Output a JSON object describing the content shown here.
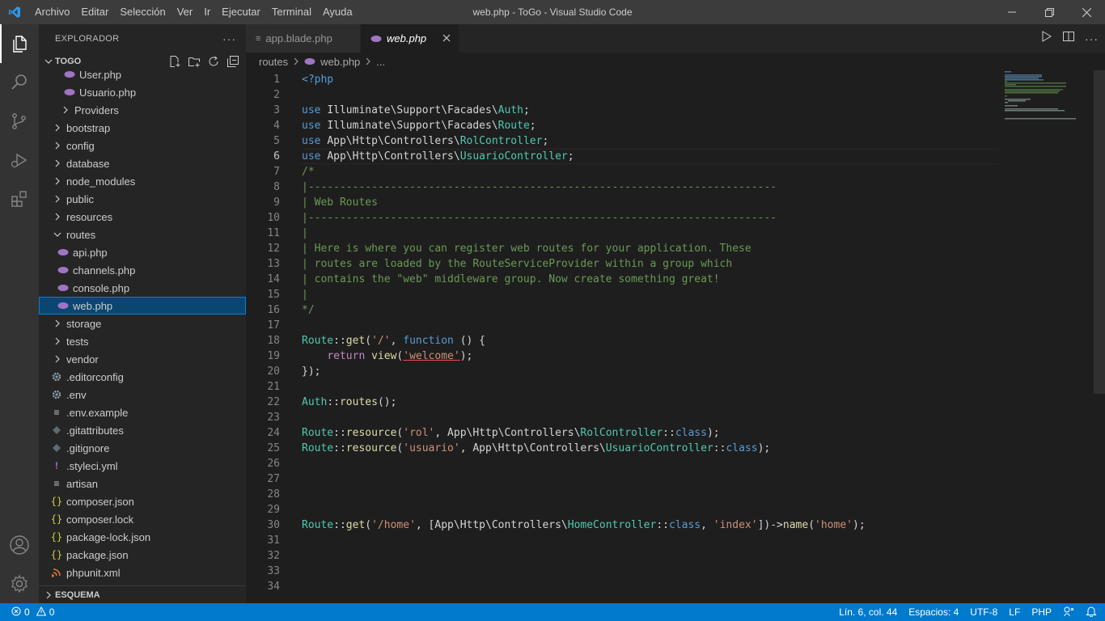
{
  "titlebar": {
    "menu": [
      "Archivo",
      "Editar",
      "Selección",
      "Ver",
      "Ir",
      "Ejecutar",
      "Terminal",
      "Ayuda"
    ],
    "title": "web.php - ToGo - Visual Studio Code"
  },
  "sidebar": {
    "header": "EXPLORADOR",
    "project": "TOGO",
    "outline": "ESQUEMA",
    "tree": [
      {
        "label": "User.php",
        "kind": "php",
        "depth": 2
      },
      {
        "label": "Usuario.php",
        "kind": "php",
        "depth": 2
      },
      {
        "label": "Providers",
        "kind": "folder",
        "depth": 2
      },
      {
        "label": "bootstrap",
        "kind": "folder",
        "depth": 1
      },
      {
        "label": "config",
        "kind": "folder",
        "depth": 1
      },
      {
        "label": "database",
        "kind": "folder",
        "depth": 1
      },
      {
        "label": "node_modules",
        "kind": "folder",
        "depth": 1
      },
      {
        "label": "public",
        "kind": "folder",
        "depth": 1
      },
      {
        "label": "resources",
        "kind": "folder",
        "depth": 1
      },
      {
        "label": "routes",
        "kind": "folder-open",
        "depth": 1
      },
      {
        "label": "api.php",
        "kind": "php",
        "depth": 2
      },
      {
        "label": "channels.php",
        "kind": "php",
        "depth": 2
      },
      {
        "label": "console.php",
        "kind": "php",
        "depth": 2
      },
      {
        "label": "web.php",
        "kind": "php",
        "depth": 2,
        "selected": true
      },
      {
        "label": "storage",
        "kind": "folder",
        "depth": 1
      },
      {
        "label": "tests",
        "kind": "folder",
        "depth": 1
      },
      {
        "label": "vendor",
        "kind": "folder",
        "depth": 1
      },
      {
        "label": ".editorconfig",
        "kind": "gear",
        "depth": 1
      },
      {
        "label": ".env",
        "kind": "gear",
        "depth": 1
      },
      {
        "label": ".env.example",
        "kind": "lines",
        "depth": 1
      },
      {
        "label": ".gitattributes",
        "kind": "git",
        "depth": 1
      },
      {
        "label": ".gitignore",
        "kind": "git",
        "depth": 1
      },
      {
        "label": ".styleci.yml",
        "kind": "yml",
        "depth": 1
      },
      {
        "label": "artisan",
        "kind": "lines",
        "depth": 1
      },
      {
        "label": "composer.json",
        "kind": "json",
        "depth": 1
      },
      {
        "label": "composer.lock",
        "kind": "json",
        "depth": 1
      },
      {
        "label": "package-lock.json",
        "kind": "json",
        "depth": 1
      },
      {
        "label": "package.json",
        "kind": "json",
        "depth": 1
      },
      {
        "label": "phpunit.xml",
        "kind": "rss",
        "depth": 1
      }
    ]
  },
  "tabs": [
    {
      "label": "app.blade.php",
      "active": false
    },
    {
      "label": "web.php",
      "active": true
    }
  ],
  "breadcrumb": {
    "folder": "routes",
    "file": "web.php",
    "more": "..."
  },
  "editor": {
    "current_line": 6,
    "lines": [
      [
        [
          "tag",
          "<?php"
        ]
      ],
      [],
      [
        [
          "kw",
          "use "
        ],
        [
          "pl",
          "Illuminate\\Support\\Facades\\"
        ],
        [
          "cls",
          "Auth"
        ],
        [
          "pl",
          ";"
        ]
      ],
      [
        [
          "kw",
          "use "
        ],
        [
          "pl",
          "Illuminate\\Support\\Facades\\"
        ],
        [
          "cls",
          "Route"
        ],
        [
          "pl",
          ";"
        ]
      ],
      [
        [
          "kw",
          "use "
        ],
        [
          "pl",
          "App\\Http\\Controllers\\"
        ],
        [
          "cls",
          "RolController"
        ],
        [
          "pl",
          ";"
        ]
      ],
      [
        [
          "kw",
          "use "
        ],
        [
          "pl",
          "App\\Http\\Controllers\\"
        ],
        [
          "cls",
          "UsuarioController"
        ],
        [
          "pl",
          ";"
        ]
      ],
      [
        [
          "cm",
          "/*"
        ]
      ],
      [
        [
          "cm",
          "|--------------------------------------------------------------------------"
        ]
      ],
      [
        [
          "cm",
          "| Web Routes"
        ]
      ],
      [
        [
          "cm",
          "|--------------------------------------------------------------------------"
        ]
      ],
      [
        [
          "cm",
          "|"
        ]
      ],
      [
        [
          "cm",
          "| Here is where you can register web routes for your application. These"
        ]
      ],
      [
        [
          "cm",
          "| routes are loaded by the RouteServiceProvider within a group which"
        ]
      ],
      [
        [
          "cm",
          "| contains the \"web\" middleware group. Now create something great!"
        ]
      ],
      [
        [
          "cm",
          "|"
        ]
      ],
      [
        [
          "cm",
          "*/"
        ]
      ],
      [],
      [
        [
          "cls",
          "Route"
        ],
        [
          "pl",
          "::"
        ],
        [
          "fn",
          "get"
        ],
        [
          "pl",
          "("
        ],
        [
          "str",
          "'/'"
        ],
        [
          "pl",
          ", "
        ],
        [
          "kw",
          "function"
        ],
        [
          "pl",
          " () {"
        ]
      ],
      [
        [
          "pl",
          "    "
        ],
        [
          "ctl",
          "return "
        ],
        [
          "fn",
          "view"
        ],
        [
          "pl",
          "("
        ],
        [
          "str",
          "'welcome'"
        ],
        [
          "pl",
          ");"
        ]
      ],
      [
        [
          "pl",
          "});"
        ]
      ],
      [],
      [
        [
          "cls",
          "Auth"
        ],
        [
          "pl",
          "::"
        ],
        [
          "fn",
          "routes"
        ],
        [
          "pl",
          "();"
        ]
      ],
      [],
      [
        [
          "cls",
          "Route"
        ],
        [
          "pl",
          "::"
        ],
        [
          "fn",
          "resource"
        ],
        [
          "pl",
          "("
        ],
        [
          "str",
          "'rol'"
        ],
        [
          "pl",
          ", App\\Http\\Controllers\\"
        ],
        [
          "cls",
          "RolController"
        ],
        [
          "pl",
          "::"
        ],
        [
          "kw",
          "class"
        ],
        [
          "pl",
          ");"
        ]
      ],
      [
        [
          "cls",
          "Route"
        ],
        [
          "pl",
          "::"
        ],
        [
          "fn",
          "resource"
        ],
        [
          "pl",
          "("
        ],
        [
          "str",
          "'usuario'"
        ],
        [
          "pl",
          ", App\\Http\\Controllers\\"
        ],
        [
          "cls",
          "UsuarioController"
        ],
        [
          "pl",
          "::"
        ],
        [
          "kw",
          "class"
        ],
        [
          "pl",
          ");"
        ]
      ],
      [],
      [],
      [],
      [],
      [
        [
          "cls",
          "Route"
        ],
        [
          "pl",
          "::"
        ],
        [
          "fn",
          "get"
        ],
        [
          "pl",
          "("
        ],
        [
          "str",
          "'/home'"
        ],
        [
          "pl",
          ", [App\\Http\\Controllers\\"
        ],
        [
          "cls",
          "HomeController"
        ],
        [
          "pl",
          "::"
        ],
        [
          "kw",
          "class"
        ],
        [
          "pl",
          ", "
        ],
        [
          "str",
          "'index'"
        ],
        [
          "pl",
          "])->"
        ],
        [
          "fn",
          "name"
        ],
        [
          "pl",
          "("
        ],
        [
          "str",
          "'home'"
        ],
        [
          "pl",
          ");"
        ]
      ],
      [],
      [],
      [],
      []
    ]
  },
  "statusbar": {
    "errors": "0",
    "warnings": "0",
    "position": "Lín. 6, col. 44",
    "spaces": "Espacios: 4",
    "encoding": "UTF-8",
    "eol": "LF",
    "language": "PHP"
  },
  "colors": {
    "accent": "#007acc",
    "selection": "#094771"
  }
}
